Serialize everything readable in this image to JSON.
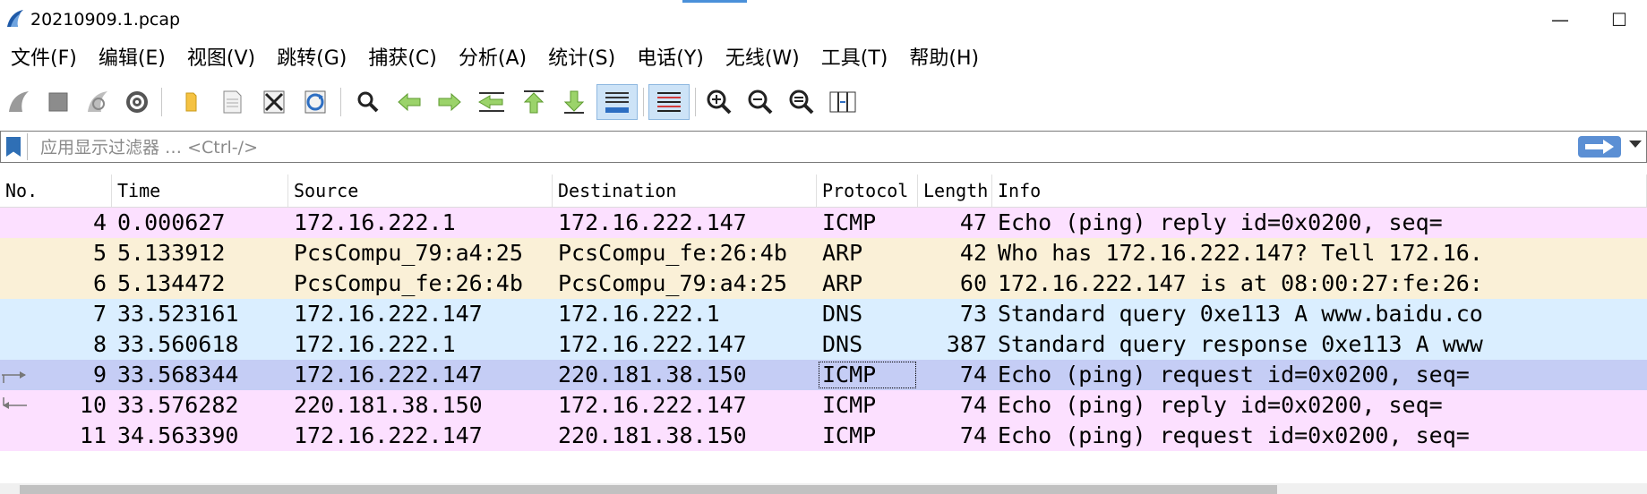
{
  "window": {
    "title": "20210909.1.pcap",
    "minimize_glyph": "—",
    "maximize_glyph": "☐"
  },
  "menu": [
    {
      "label": "文件(F)",
      "name": "menu-file"
    },
    {
      "label": "编辑(E)",
      "name": "menu-edit"
    },
    {
      "label": "视图(V)",
      "name": "menu-view"
    },
    {
      "label": "跳转(G)",
      "name": "menu-go"
    },
    {
      "label": "捕获(C)",
      "name": "menu-capture"
    },
    {
      "label": "分析(A)",
      "name": "menu-analyze"
    },
    {
      "label": "统计(S)",
      "name": "menu-statistics"
    },
    {
      "label": "电话(Y)",
      "name": "menu-telephony"
    },
    {
      "label": "无线(W)",
      "name": "menu-wireless"
    },
    {
      "label": "工具(T)",
      "name": "menu-tools"
    },
    {
      "label": "帮助(H)",
      "name": "menu-help"
    }
  ],
  "toolbar": {
    "buttons": [
      "start-capture-icon",
      "stop-capture-icon",
      "restart-capture-icon",
      "capture-options-icon",
      "open-file-icon",
      "save-file-icon",
      "close-file-icon",
      "reload-file-icon",
      "find-packet-icon",
      "go-back-icon",
      "go-forward-icon",
      "go-to-packet-icon",
      "go-first-packet-icon",
      "go-last-packet-icon",
      "autoscroll-icon",
      "colorize-icon",
      "zoom-in-icon",
      "zoom-out-icon",
      "normal-size-icon",
      "resize-columns-icon"
    ]
  },
  "filter": {
    "placeholder": "应用显示过滤器 … <Ctrl-/>"
  },
  "packet_list": {
    "columns": [
      "No.",
      "Time",
      "Source",
      "Destination",
      "Protocol",
      "Length",
      "Info"
    ],
    "rows": [
      {
        "no": "4",
        "time": "0.000627",
        "source": "172.16.222.1",
        "destination": "172.16.222.147",
        "protocol": "ICMP",
        "length": "47",
        "info": "Echo (ping) reply    id=0x0200, seq=",
        "color": "#fce0ff"
      },
      {
        "no": "5",
        "time": "5.133912",
        "source": "PcsCompu_79:a4:25",
        "destination": "PcsCompu_fe:26:4b",
        "protocol": "ARP",
        "length": "42",
        "info": "Who has 172.16.222.147? Tell 172.16.",
        "color": "#faf0d7"
      },
      {
        "no": "6",
        "time": "5.134472",
        "source": "PcsCompu_fe:26:4b",
        "destination": "PcsCompu_79:a4:25",
        "protocol": "ARP",
        "length": "60",
        "info": "172.16.222.147 is at 08:00:27:fe:26:",
        "color": "#faf0d7"
      },
      {
        "no": "7",
        "time": "33.523161",
        "source": "172.16.222.147",
        "destination": "172.16.222.1",
        "protocol": "DNS",
        "length": "73",
        "info": "Standard query 0xe113 A www.baidu.co",
        "color": "#daeeff"
      },
      {
        "no": "8",
        "time": "33.560618",
        "source": "172.16.222.1",
        "destination": "172.16.222.147",
        "protocol": "DNS",
        "length": "387",
        "info": "Standard query response 0xe113 A www",
        "color": "#daeeff"
      },
      {
        "no": "9",
        "time": "33.568344",
        "source": "172.16.222.147",
        "destination": "220.181.38.150",
        "protocol": "ICMP",
        "length": "74",
        "info": "Echo (ping) request  id=0x0200, seq=",
        "color": "#c5cdf5",
        "selected": true
      },
      {
        "no": "10",
        "time": "33.576282",
        "source": "220.181.38.150",
        "destination": "172.16.222.147",
        "protocol": "ICMP",
        "length": "74",
        "info": "Echo (ping) reply    id=0x0200, seq=",
        "color": "#fce0ff"
      },
      {
        "no": "11",
        "time": "34.563390",
        "source": "172.16.222.147",
        "destination": "220.181.38.150",
        "protocol": "ICMP",
        "length": "74",
        "info": "Echo (ping) request  id=0x0200, seq=",
        "color": "#fce0ff"
      }
    ]
  }
}
